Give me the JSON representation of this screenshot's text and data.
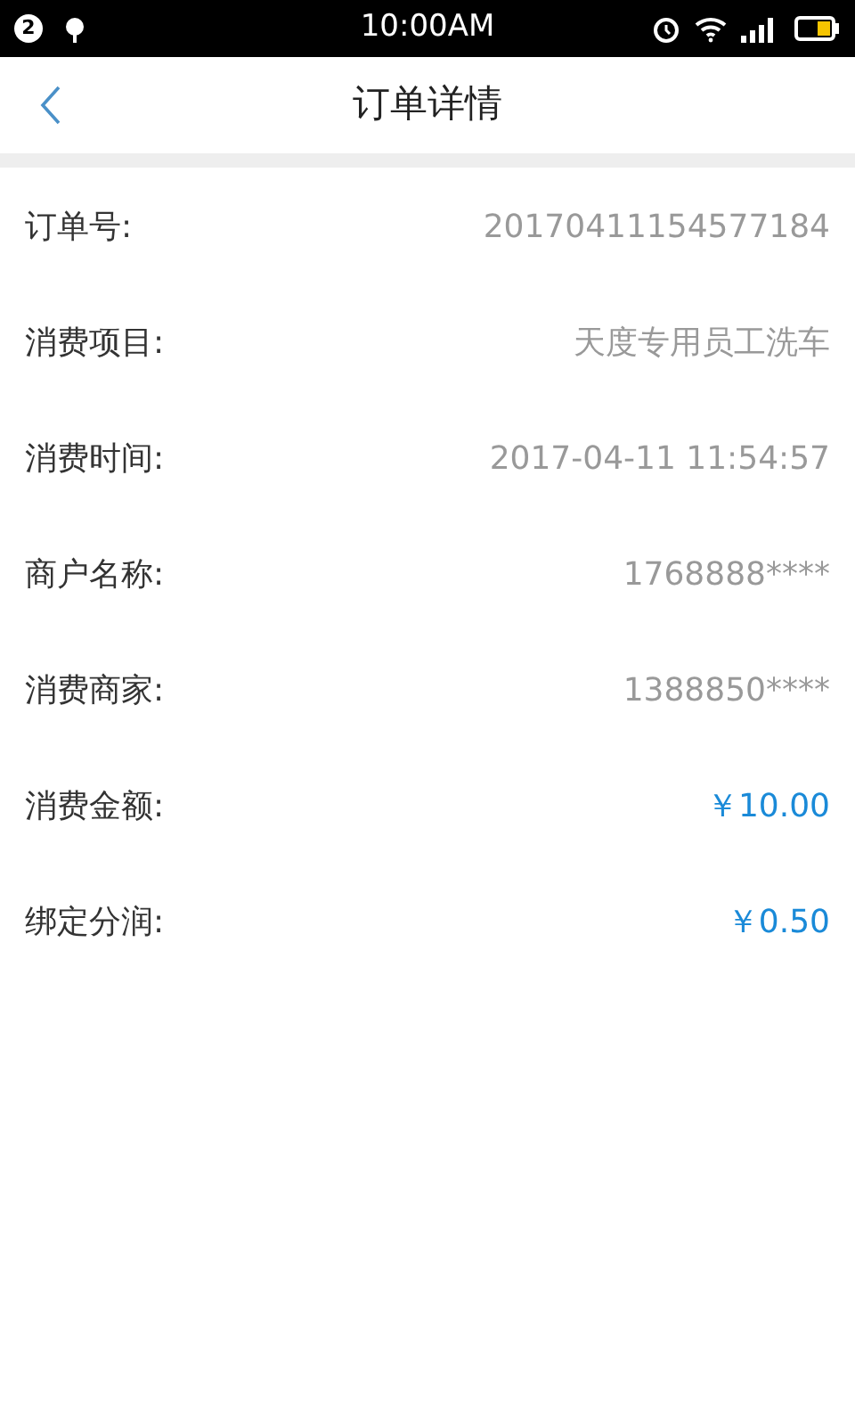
{
  "status_bar": {
    "notification_count": "2",
    "time": "10:00AM"
  },
  "header": {
    "title": "订单详情"
  },
  "rows": [
    {
      "label": "订单号:",
      "value": "20170411154577184",
      "kind": "plain"
    },
    {
      "label": "消费项目:",
      "value": "天度专用员工洗车",
      "kind": "plain"
    },
    {
      "label": "消费时间:",
      "value": "2017-04-11 11:54:57",
      "kind": "plain"
    },
    {
      "label": "商户名称:",
      "value": "1768888****",
      "kind": "plain"
    },
    {
      "label": "消费商家:",
      "value": "1388850****",
      "kind": "plain"
    },
    {
      "label": "消费金额:",
      "value": "￥10.00",
      "kind": "amount"
    },
    {
      "label": "绑定分润:",
      "value": "￥0.50",
      "kind": "amount"
    }
  ]
}
